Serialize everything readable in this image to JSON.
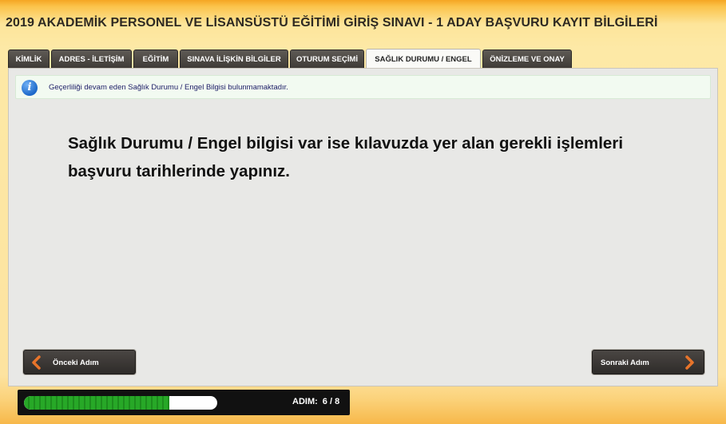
{
  "header": {
    "title": "2019 AKADEMİK PERSONEL VE LİSANSÜSTÜ EĞİTİMİ GİRİŞ SINAVI - 1 ADAY BAŞVURU KAYIT BİLGİLERİ"
  },
  "tabs": [
    {
      "label": "KİMLİK"
    },
    {
      "label": "ADRES - İLETİŞİM"
    },
    {
      "label": "EĞİTİM"
    },
    {
      "label": "SINAVA İLİŞKİN BİLGİLER"
    },
    {
      "label": "OTURUM SEÇİMİ"
    },
    {
      "label": "SAĞLIK DURUMU / ENGEL"
    },
    {
      "label": "ÖNİZLEME VE ONAY"
    }
  ],
  "active_tab": "SAĞLIK DURUMU / ENGEL",
  "info": {
    "icon": "info-icon",
    "text": "Geçerliliği devam eden Sağlık Durumu / Engel Bilgisi bulunmamaktadır."
  },
  "message": {
    "text": "Sağlık Durumu / Engel bilgisi var ise kılavuzda yer alan gerekli işlemleri başvuru tarihlerinde yapınız."
  },
  "buttons": {
    "previous_label": "Önceki Adım",
    "next_label": "Sonraki Adım"
  },
  "progress": {
    "step_label": "ADIM:",
    "step_value": "6 / 8",
    "current": 6,
    "total": 8
  },
  "colors": {
    "accent_orange": "#e8742a",
    "progress_green": "#27a827",
    "tab_dark": "#3f3b37"
  }
}
